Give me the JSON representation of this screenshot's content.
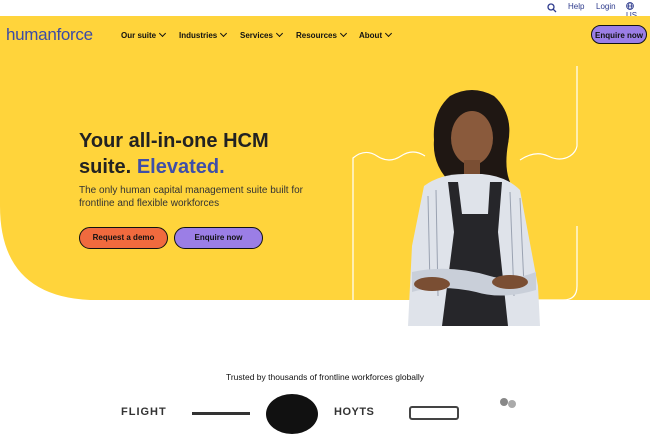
{
  "topbar": {
    "help": "Help",
    "login": "Login",
    "region": "US"
  },
  "brand": {
    "name": "humanforce"
  },
  "nav": {
    "items": [
      {
        "label": "Our suite"
      },
      {
        "label": "Industries"
      },
      {
        "label": "Services"
      },
      {
        "label": "Resources"
      },
      {
        "label": "About"
      }
    ],
    "cta": "Enquire now"
  },
  "hero": {
    "title_line1": "Your all-in-one HCM",
    "title_line2": "suite.",
    "title_accent": "Elevated.",
    "subtitle": "The only human capital management suite built for frontline and flexible workforces",
    "primary_button": "Request a demo",
    "secondary_button": "Enquire now"
  },
  "trust": {
    "text": "Trusted by thousands of frontline workforces globally",
    "logos": [
      "FLIGHT",
      "HOYTS"
    ]
  },
  "colors": {
    "hero_bg": "#ffd43b",
    "accent": "#3f4fa8",
    "orange": "#f06a3e",
    "purple": "#9b7ee6"
  }
}
